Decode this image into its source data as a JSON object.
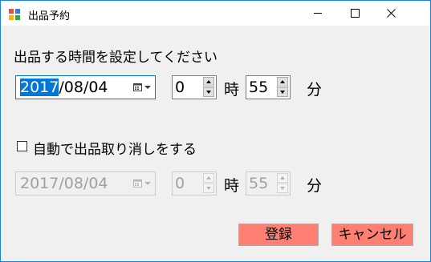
{
  "window": {
    "title": "出品予約",
    "controls": {
      "minimize": "minimize",
      "maximize": "maximize",
      "close": "close"
    }
  },
  "form": {
    "prompt": "出品する時間を設定してください",
    "start": {
      "date_selected_part": "2017",
      "date_rest": "/08/04",
      "hour": "0",
      "hour_unit": "時",
      "minute": "55",
      "minute_unit": "分"
    },
    "end_enabled_label": "自動で出品取り消しをする",
    "end_enabled_checked": false,
    "end": {
      "date": "2017/08/04",
      "hour": "0",
      "hour_unit": "時",
      "minute": "55",
      "minute_unit": "分"
    }
  },
  "buttons": {
    "register": "登録",
    "cancel": "キャンセル"
  },
  "colors": {
    "button_bg": "#ff7f73",
    "selection": "#0078d7",
    "window_border": "#1883d7"
  },
  "icons": [
    "app-icon",
    "calendar-icon",
    "chevron-down-icon",
    "spin-up-icon",
    "spin-down-icon",
    "close-icon"
  ]
}
